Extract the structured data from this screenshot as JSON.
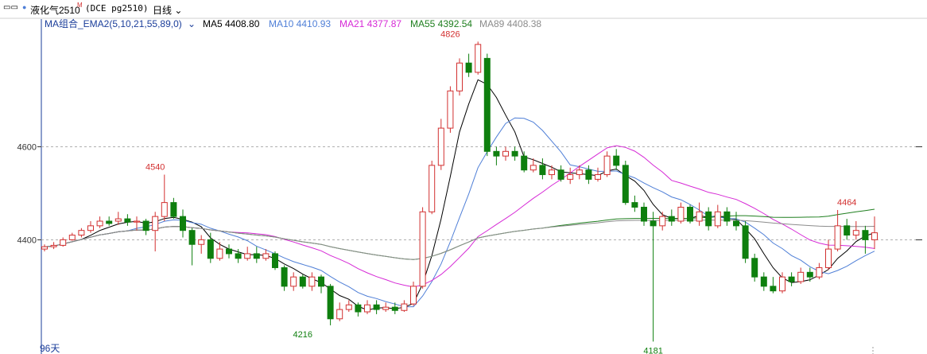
{
  "header": {
    "title": "液化气2510",
    "title_sup": "M",
    "code": "(DCE pg2510)",
    "period": "日线",
    "icon": "chart-toggle-icon"
  },
  "legend": {
    "group_label": "MA组合_EMA2(5,10,21,55,89,0)",
    "items": [
      {
        "label": "MA5",
        "value": "4408.80",
        "color": "#000000"
      },
      {
        "label": "MA10",
        "value": "4410.93",
        "color": "#4f7fd7"
      },
      {
        "label": "MA21",
        "value": "4377.87",
        "color": "#d629d6"
      },
      {
        "label": "MA55",
        "value": "4392.54",
        "color": "#1f7f1f"
      },
      {
        "label": "MA89",
        "value": "4408.38",
        "color": "#8c8c8c"
      }
    ]
  },
  "footer": {
    "days_label": "96天"
  },
  "colors": {
    "up": "#d23030",
    "down": "#0e7f0e",
    "grid": "#b0b0b0"
  },
  "chart_data": {
    "type": "candlestick",
    "yticks": [
      4400,
      4600
    ],
    "ylim": [
      4180,
      4830
    ],
    "annotations": [
      {
        "text": "4540",
        "index": 12,
        "value": 4540,
        "pos": "above"
      },
      {
        "text": "4826",
        "index": 44,
        "value": 4826,
        "pos": "above"
      },
      {
        "text": "4216",
        "index": 28,
        "value": 4216,
        "pos": "below"
      },
      {
        "text": "4181",
        "index": 66,
        "value": 4181,
        "pos": "below"
      },
      {
        "text": "4464",
        "index": 87,
        "value": 4464,
        "pos": "above"
      }
    ],
    "candles": [
      [
        4380,
        4385,
        4375,
        4390
      ],
      [
        4385,
        4388,
        4380,
        4395
      ],
      [
        4388,
        4400,
        4385,
        4405
      ],
      [
        4400,
        4410,
        4398,
        4415
      ],
      [
        4410,
        4420,
        4405,
        4425
      ],
      [
        4420,
        4430,
        4415,
        4440
      ],
      [
        4430,
        4440,
        4425,
        4450
      ],
      [
        4440,
        4435,
        4430,
        4450
      ],
      [
        4440,
        4445,
        4432,
        4460
      ],
      [
        4445,
        4438,
        4430,
        4455
      ],
      [
        4438,
        4440,
        4420,
        4450
      ],
      [
        4440,
        4420,
        4410,
        4445
      ],
      [
        4420,
        4450,
        4375,
        4460
      ],
      [
        4450,
        4480,
        4440,
        4540
      ],
      [
        4480,
        4450,
        4445,
        4490
      ],
      [
        4450,
        4420,
        4405,
        4465
      ],
      [
        4420,
        4390,
        4345,
        4425
      ],
      [
        4390,
        4400,
        4370,
        4410
      ],
      [
        4400,
        4360,
        4350,
        4415
      ],
      [
        4360,
        4380,
        4355,
        4395
      ],
      [
        4380,
        4370,
        4360,
        4390
      ],
      [
        4370,
        4360,
        4350,
        4380
      ],
      [
        4360,
        4370,
        4355,
        4385
      ],
      [
        4370,
        4360,
        4350,
        4385
      ],
      [
        4360,
        4370,
        4355,
        4380
      ],
      [
        4370,
        4340,
        4335,
        4375
      ],
      [
        4340,
        4300,
        4290,
        4345
      ],
      [
        4300,
        4320,
        4290,
        4330
      ],
      [
        4320,
        4300,
        4295,
        4325
      ],
      [
        4300,
        4320,
        4290,
        4330
      ],
      [
        4320,
        4300,
        4285,
        4325
      ],
      [
        4300,
        4230,
        4216,
        4305
      ],
      [
        4230,
        4250,
        4225,
        4265
      ],
      [
        4250,
        4260,
        4245,
        4270
      ],
      [
        4260,
        4245,
        4235,
        4265
      ],
      [
        4245,
        4260,
        4240,
        4270
      ],
      [
        4260,
        4250,
        4240,
        4270
      ],
      [
        4250,
        4255,
        4245,
        4265
      ],
      [
        4255,
        4248,
        4240,
        4265
      ],
      [
        4248,
        4262,
        4245,
        4270
      ],
      [
        4262,
        4300,
        4258,
        4310
      ],
      [
        4300,
        4460,
        4295,
        4470
      ],
      [
        4460,
        4560,
        4455,
        4570
      ],
      [
        4560,
        4640,
        4550,
        4660
      ],
      [
        4640,
        4720,
        4630,
        4730
      ],
      [
        4720,
        4780,
        4710,
        4790
      ],
      [
        4780,
        4760,
        4750,
        4800
      ],
      [
        4760,
        4820,
        4755,
        4826
      ],
      [
        4790,
        4590,
        4580,
        4800
      ],
      [
        4590,
        4580,
        4560,
        4600
      ],
      [
        4580,
        4590,
        4570,
        4600
      ],
      [
        4590,
        4580,
        4570,
        4600
      ],
      [
        4580,
        4550,
        4545,
        4590
      ],
      [
        4550,
        4560,
        4545,
        4575
      ],
      [
        4560,
        4540,
        4530,
        4575
      ],
      [
        4540,
        4550,
        4530,
        4560
      ],
      [
        4550,
        4530,
        4525,
        4560
      ],
      [
        4530,
        4540,
        4520,
        4555
      ],
      [
        4540,
        4550,
        4530,
        4560
      ],
      [
        4550,
        4530,
        4520,
        4560
      ],
      [
        4530,
        4540,
        4525,
        4555
      ],
      [
        4540,
        4580,
        4535,
        4590
      ],
      [
        4580,
        4560,
        4550,
        4595
      ],
      [
        4560,
        4480,
        4475,
        4570
      ],
      [
        4480,
        4470,
        4460,
        4495
      ],
      [
        4470,
        4440,
        4430,
        4480
      ],
      [
        4440,
        4430,
        4181,
        4460
      ],
      [
        4430,
        4450,
        4420,
        4460
      ],
      [
        4450,
        4440,
        4430,
        4465
      ],
      [
        4440,
        4470,
        4435,
        4480
      ],
      [
        4470,
        4440,
        4435,
        4475
      ],
      [
        4440,
        4460,
        4430,
        4480
      ],
      [
        4460,
        4430,
        4420,
        4470
      ],
      [
        4430,
        4460,
        4425,
        4475
      ],
      [
        4460,
        4440,
        4430,
        4470
      ],
      [
        4440,
        4430,
        4420,
        4460
      ],
      [
        4430,
        4360,
        4350,
        4440
      ],
      [
        4360,
        4320,
        4310,
        4370
      ],
      [
        4320,
        4300,
        4290,
        4330
      ],
      [
        4300,
        4290,
        4285,
        4320
      ],
      [
        4290,
        4320,
        4285,
        4330
      ],
      [
        4320,
        4310,
        4300,
        4330
      ],
      [
        4310,
        4330,
        4305,
        4340
      ],
      [
        4330,
        4320,
        4310,
        4340
      ],
      [
        4320,
        4340,
        4315,
        4350
      ],
      [
        4340,
        4380,
        4335,
        4400
      ],
      [
        4380,
        4430,
        4375,
        4464
      ],
      [
        4430,
        4410,
        4400,
        4445
      ],
      [
        4410,
        4420,
        4400,
        4440
      ],
      [
        4420,
        4400,
        4370,
        4430
      ],
      [
        4400,
        4415,
        4380,
        4450
      ]
    ]
  }
}
